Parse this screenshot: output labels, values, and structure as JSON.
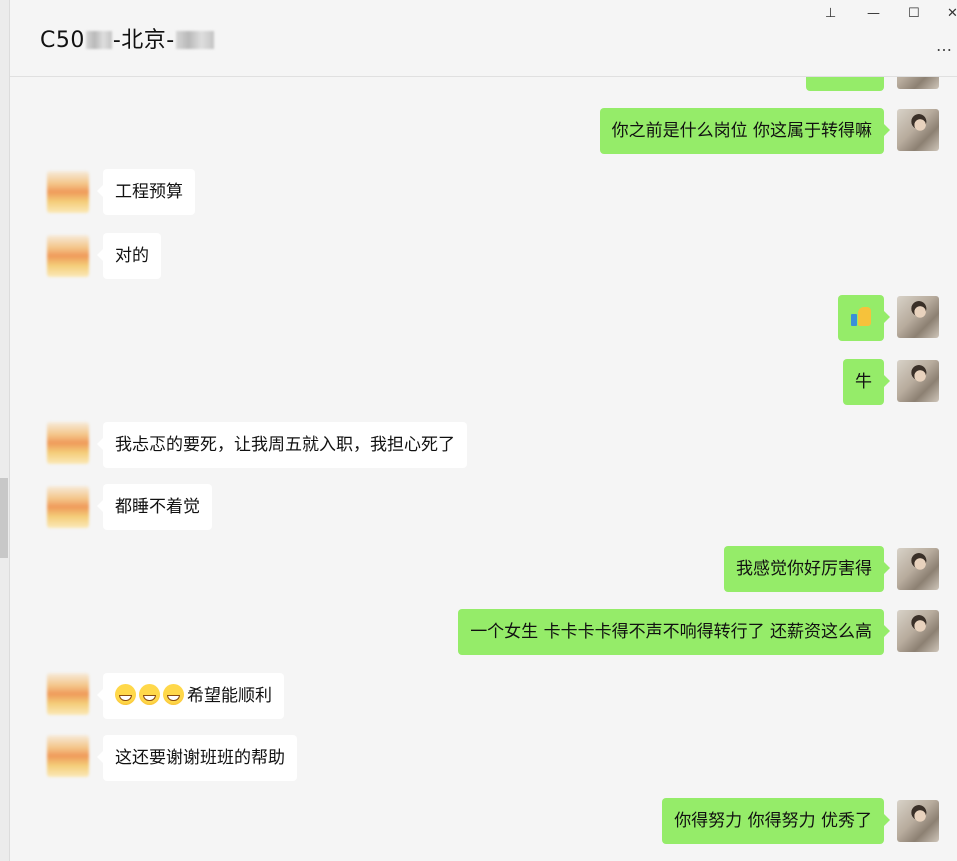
{
  "window": {
    "title_prefix": "C50",
    "title_middle": "-北京-",
    "controls": {
      "pin": "⊥",
      "minimize": "—",
      "maximize": "☐",
      "close": "✕",
      "more": "…"
    }
  },
  "messages": [
    {
      "side": "me",
      "text": "你之前是什么岗位 你这属于转得嘛"
    },
    {
      "side": "other",
      "text": "工程预算"
    },
    {
      "side": "other",
      "text": "对的"
    },
    {
      "side": "me",
      "text": "",
      "icon": "thumbs-up-icon"
    },
    {
      "side": "me",
      "text": "牛"
    },
    {
      "side": "other",
      "text": "我忐忑的要死，让我周五就入职，我担心死了"
    },
    {
      "side": "other",
      "text": "都睡不着觉"
    },
    {
      "side": "me",
      "text": "我感觉你好厉害得"
    },
    {
      "side": "me",
      "text": "一个女生 卡卡卡卡得不声不响得转行了 还薪资这么高"
    },
    {
      "side": "other",
      "text": "希望能顺利",
      "emoji_count": 3
    },
    {
      "side": "other",
      "text": "这还要谢谢班班的帮助"
    },
    {
      "side": "me",
      "text": "你得努力 你得努力  优秀了"
    }
  ],
  "colors": {
    "my_bubble": "#95ec69",
    "other_bubble": "#ffffff",
    "background": "#f5f5f5"
  }
}
